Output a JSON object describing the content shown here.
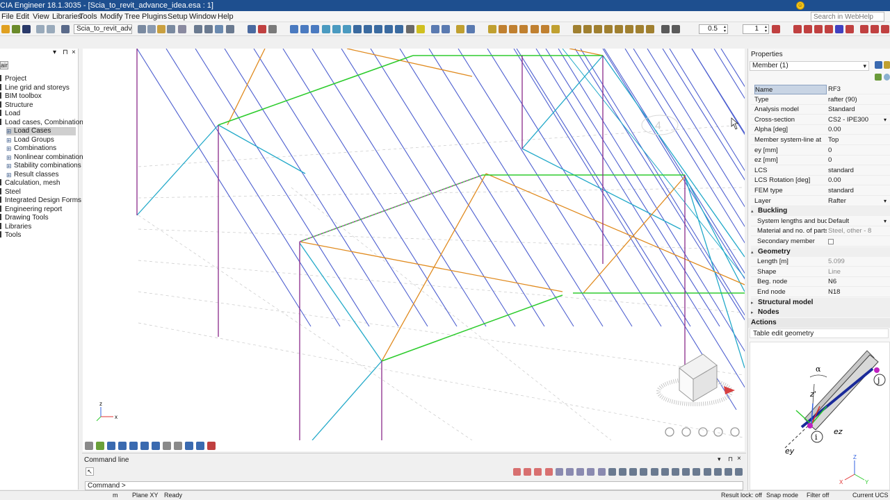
{
  "app": {
    "title": "CIA Engineer 18.1.3035 - [Scia_to_revit_advance_idea.esa : 1]"
  },
  "menu": [
    "File",
    "Edit",
    "View",
    "Libraries",
    "Tools",
    "Modify",
    "Tree",
    "Plugins",
    "Setup",
    "Window",
    "Help"
  ],
  "search": {
    "placeholder": "Search in WebHelp"
  },
  "toolbar": {
    "project_combo": "Scia_to_revit_advance_",
    "spin_a": "0.5",
    "spin_b": "1"
  },
  "left_panel": {
    "tab": "ain",
    "tree": [
      {
        "label": "Project",
        "level": 0,
        "selected": false
      },
      {
        "label": "Line grid and storeys",
        "level": 0,
        "selected": false
      },
      {
        "label": "BIM toolbox",
        "level": 0,
        "selected": false
      },
      {
        "label": "Structure",
        "level": 0,
        "selected": false
      },
      {
        "label": "Load",
        "level": 0,
        "selected": false
      },
      {
        "label": "Load cases, Combinations",
        "level": 0,
        "selected": false
      },
      {
        "label": "Load Cases",
        "level": 1,
        "selected": true
      },
      {
        "label": "Load Groups",
        "level": 1,
        "selected": false
      },
      {
        "label": "Combinations",
        "level": 1,
        "selected": false
      },
      {
        "label": "Nonlinear combination",
        "level": 1,
        "selected": false
      },
      {
        "label": "Stability combinations",
        "level": 1,
        "selected": false
      },
      {
        "label": "Result classes",
        "level": 1,
        "selected": false
      },
      {
        "label": "Calculation, mesh",
        "level": 0,
        "selected": false
      },
      {
        "label": "Steel",
        "level": 0,
        "selected": false
      },
      {
        "label": "Integrated Design Forms",
        "level": 0,
        "selected": false
      },
      {
        "label": "Engineering report",
        "level": 0,
        "selected": false
      },
      {
        "label": "Drawing Tools",
        "level": 0,
        "selected": false
      },
      {
        "label": "Libraries",
        "level": 0,
        "selected": false
      },
      {
        "label": "Tools",
        "level": 0,
        "selected": false
      }
    ]
  },
  "viewport": {
    "label_4": "4",
    "axis_z": "z",
    "axis_x": "x",
    "colors": {
      "blue": "#4d5fd0",
      "cyan": "#22a9c9",
      "green": "#2ecc2e",
      "orange": "#e08a1e",
      "purple": "#8a2a8a",
      "magenta": "#d040d0",
      "grid": "#c8c8c8"
    }
  },
  "command": {
    "title": "Command line",
    "prompt": "Command >"
  },
  "status": {
    "unit": "m",
    "plane": "Plane XY",
    "state": "Ready",
    "result_lock": "Result lock: off",
    "snap": "Snap mode",
    "filter": "Filter off",
    "ucs": "Current UCS"
  },
  "properties": {
    "title": "Properties",
    "selection": "Member (1)",
    "rows": [
      {
        "label": "Name",
        "value": "RF3"
      },
      {
        "label": "Type",
        "value": "rafter (90)"
      },
      {
        "label": "Analysis model",
        "value": "Standard"
      },
      {
        "label": "Cross-section",
        "value": "CS2 - IPE300"
      },
      {
        "label": "Alpha [deg]",
        "value": "0.00"
      },
      {
        "label": "Member system-line at",
        "value": "Top"
      },
      {
        "label": "ey [mm]",
        "value": "0"
      },
      {
        "label": "ez [mm]",
        "value": "0"
      },
      {
        "label": "LCS",
        "value": "standard"
      },
      {
        "label": "LCS Rotation [deg]",
        "value": "0.00"
      },
      {
        "label": "FEM type",
        "value": "standard"
      },
      {
        "label": "Layer",
        "value": "Rafter"
      }
    ],
    "buckling": {
      "title": "Buckling",
      "rows": [
        {
          "label": "System lengths and buc...",
          "value": "Default"
        },
        {
          "label": "Material and no. of parts",
          "value": "Steel, other - 8"
        },
        {
          "label": "Secondary member",
          "value": ""
        }
      ]
    },
    "geometry": {
      "title": "Geometry",
      "rows": [
        {
          "label": "Length [m]",
          "value": "5.099"
        },
        {
          "label": "Shape",
          "value": "Line"
        },
        {
          "label": "Beg. node",
          "value": "N6"
        },
        {
          "label": "End node",
          "value": "N18"
        }
      ]
    },
    "structural_model": "Structural model",
    "nodes": "Nodes",
    "actions_title": "Actions",
    "actions": [
      "Table edit geometry"
    ],
    "diagram": {
      "alpha": "α",
      "z": "z'",
      "i": "i",
      "j": "j",
      "ez": "ez",
      "ey": "ey",
      "ax_z": "Z",
      "ax_x": "X",
      "ax_y": "Y"
    }
  }
}
